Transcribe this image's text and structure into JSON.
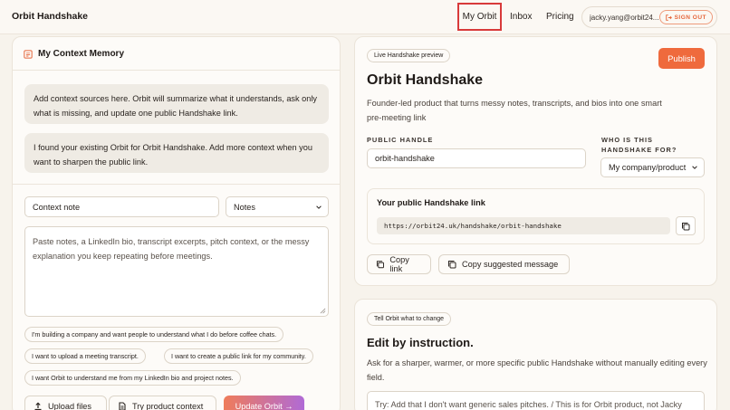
{
  "brand": "Orbit Handshake",
  "nav": {
    "my_orbit": "My Orbit",
    "inbox": "Inbox",
    "pricing": "Pricing"
  },
  "account": {
    "email": "jacky.yang@orbit24...",
    "signout": "SIGN OUT"
  },
  "context_memory": {
    "title": "My Context Memory",
    "messages": [
      "Add context sources here. Orbit will summarize what it understands, ask only what is missing, and update one public Handshake link.",
      "I found your existing Orbit for Orbit Handshake. Add more context when you want to sharpen the public link."
    ],
    "note_title_value": "Context note",
    "note_type_value": "Notes",
    "textarea_placeholder": "Paste notes, a LinkedIn bio, transcript excerpts, pitch context, or the messy explanation you keep repeating before meetings.",
    "suggestions": [
      "I'm building a company and want people to understand what I do before coffee chats.",
      "I want to upload a meeting transcript.",
      "I want to create a public link for my community.",
      "I want Orbit to understand me from my LinkedIn bio and project notes."
    ],
    "upload_label": "Upload files",
    "try_label": "Try product context",
    "update_label": "Update Orbit →"
  },
  "preview": {
    "pill": "Live Handshake preview",
    "publish": "Publish",
    "title": "Orbit Handshake",
    "description": "Founder-led product that turns messy notes, transcripts, and bios into one smart pre-meeting link",
    "handle_label": "PUBLIC HANDLE",
    "handle_value": "orbit-handshake",
    "who_label_1": "WHO IS THIS",
    "who_label_2": "HANDSHAKE FOR?",
    "who_value": "My company/product",
    "link_title": "Your public Handshake link",
    "link_url": "https://orbit24.uk/handshake/orbit-handshake",
    "copy_link": "Copy link",
    "copy_message": "Copy suggested message"
  },
  "edit": {
    "pill": "Tell Orbit what to change",
    "title": "Edit by instruction.",
    "description": "Ask for a sharper, warmer, or more specific public Handshake without manually editing every field.",
    "placeholder": "Try: Add that I don't want generic sales pitches. / This is for Orbit product, not Jacky"
  }
}
